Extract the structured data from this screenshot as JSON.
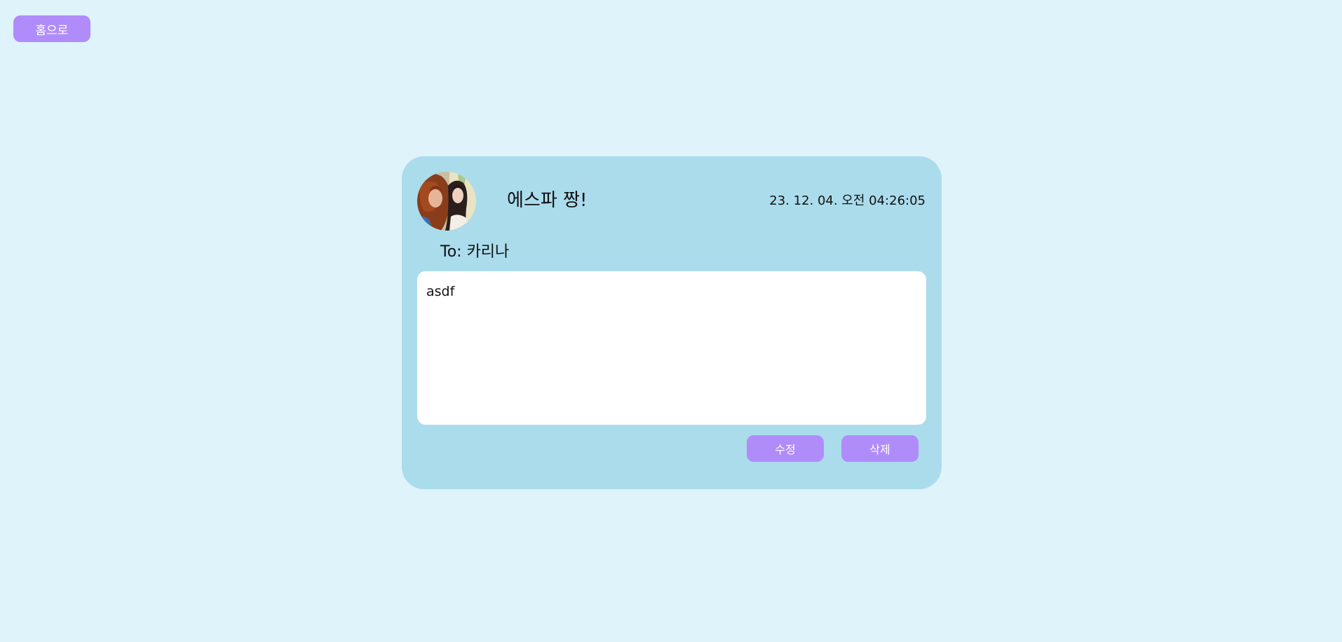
{
  "nav": {
    "home_label": "홈으로"
  },
  "post": {
    "title": "에스파 짱!",
    "timestamp": "23. 12. 04. 오전 04:26:05",
    "recipient_line": "To: 카리나",
    "content": "asdf",
    "edit_label": "수정",
    "delete_label": "삭제"
  },
  "colors": {
    "page_background": "#def3fa",
    "card_background": "#abdcec",
    "button_accent": "#b08cfa",
    "content_background": "#ffffff"
  }
}
